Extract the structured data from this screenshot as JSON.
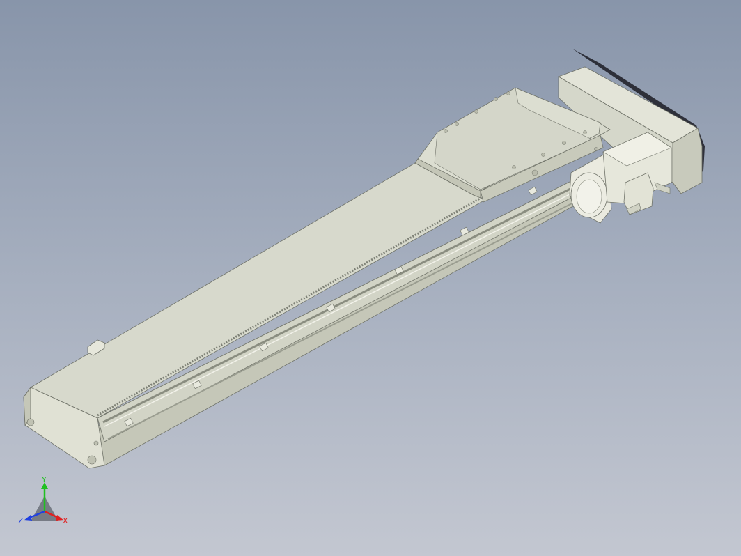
{
  "viewport": {
    "background_top": "#8895aa",
    "background_bottom": "#c3c7d1"
  },
  "model": {
    "description_icon": "linear-actuator-model",
    "colors": {
      "body_top": "#d7d9cc",
      "body_side": "#c9cbbd",
      "body_dark": "#b3b5a6",
      "edge": "#6f7268",
      "motor": "#e9e9dd",
      "shadow": "#1c1c24"
    }
  },
  "triad": {
    "x_label": "X",
    "y_label": "Y",
    "z_label": "Z",
    "x_color": "#e02020",
    "y_color": "#20c020",
    "z_color": "#2040e0"
  }
}
